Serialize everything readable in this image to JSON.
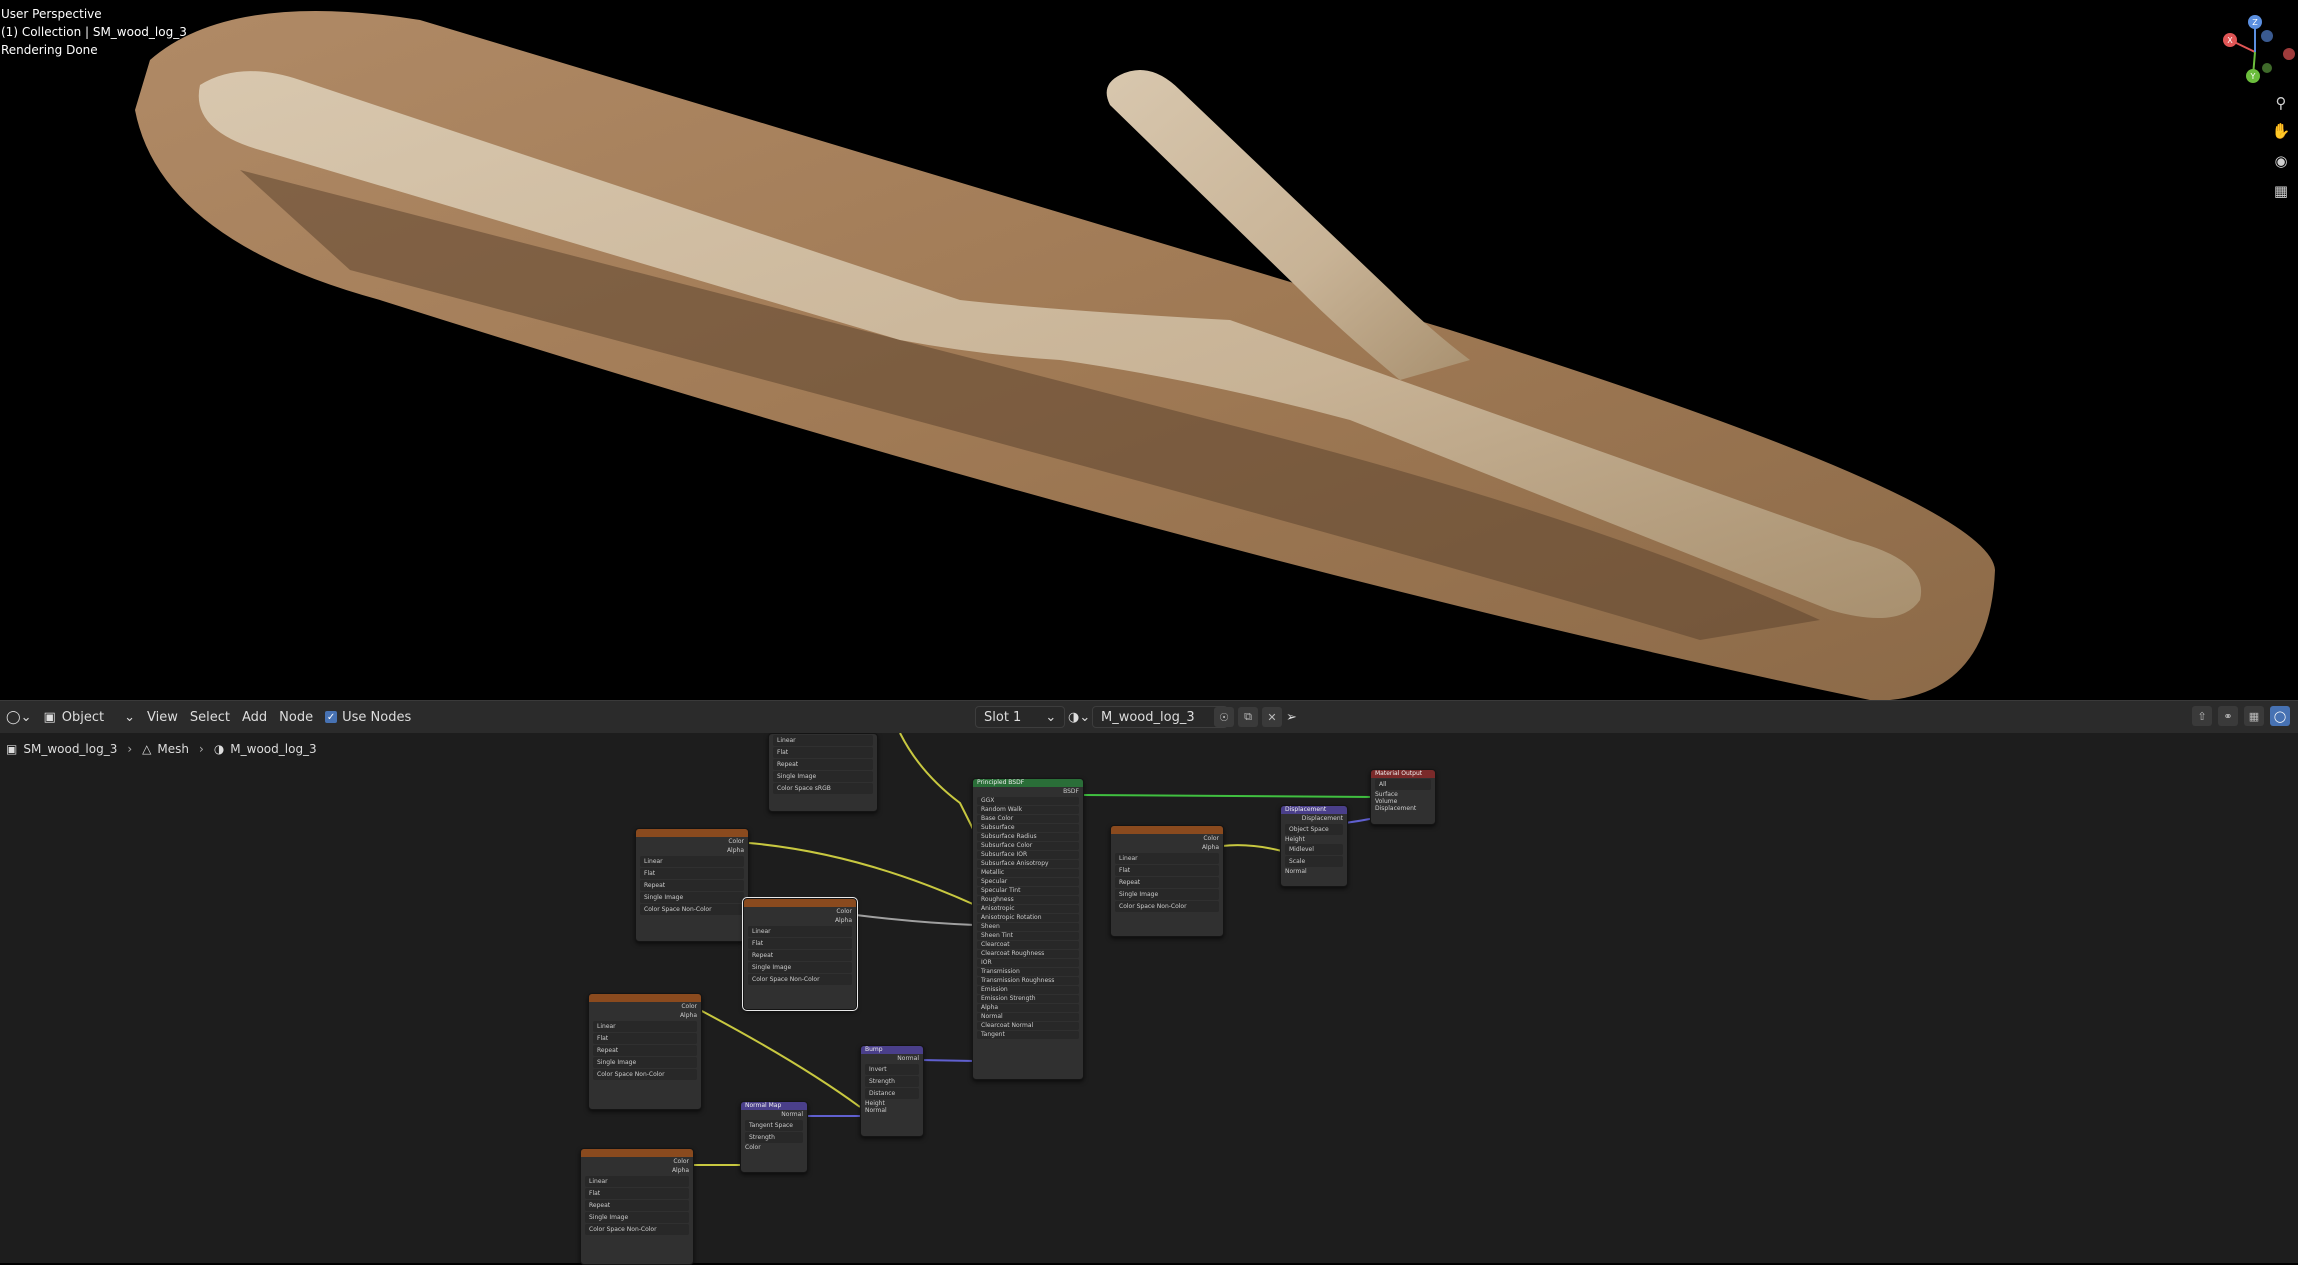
{
  "viewport": {
    "overlay_lines": [
      "User Perspective",
      "(1) Collection | SM_wood_log_3",
      "Rendering Done"
    ],
    "gizmo_axes": [
      "X",
      "Y",
      "Z"
    ]
  },
  "header": {
    "mode": "Object",
    "menus": [
      "View",
      "Select",
      "Add",
      "Node"
    ],
    "use_nodes_label": "Use Nodes",
    "slot": "Slot 1",
    "material_name": "M_wood_log_3"
  },
  "breadcrumb": {
    "object": "SM_wood_log_3",
    "data": "Mesh",
    "material": "M_wood_log_3"
  },
  "nodes": {
    "image_rows": [
      "Linear",
      "Flat",
      "Repeat",
      "Single Image"
    ],
    "color_space_label": "Color Space",
    "color_space_srgb": "sRGB",
    "color_space_noncolor": "Non-Color",
    "vector_label": "Vector",
    "color_label": "Color",
    "alpha_label": "Alpha",
    "bsdf_title": "Principled BSDF",
    "bsdf_out": "BSDF",
    "output_title": "Material Output",
    "output_target": "All",
    "output_inputs": [
      "Surface",
      "Volume",
      "Displacement"
    ],
    "displacement_title": "Displacement",
    "displacement_rows": [
      "Displacement",
      "Object Space",
      "Height",
      "Midlevel",
      "Scale",
      "Normal"
    ],
    "bump_title": "Bump",
    "bump_rows": [
      "Normal",
      "Invert",
      "Strength",
      "Distance",
      "Height",
      "Normal"
    ],
    "normalmap_title": "Normal Map",
    "normalmap_rows": [
      "Normal",
      "Tangent Space",
      "Strength",
      "Color"
    ],
    "bsdf_inputs": [
      "GGX",
      "Random Walk",
      "Base Color",
      "Subsurface",
      "Subsurface Radius",
      "Subsurface Color",
      "Subsurface IOR",
      "Subsurface Anisotropy",
      "Metallic",
      "Specular",
      "Specular Tint",
      "Roughness",
      "Anisotropic",
      "Anisotropic Rotation",
      "Sheen",
      "Sheen Tint",
      "Clearcoat",
      "Clearcoat Roughness",
      "IOR",
      "Transmission",
      "Transmission Roughness",
      "Emission",
      "Emission Strength",
      "Alpha",
      "Normal",
      "Clearcoat Normal",
      "Tangent"
    ]
  }
}
